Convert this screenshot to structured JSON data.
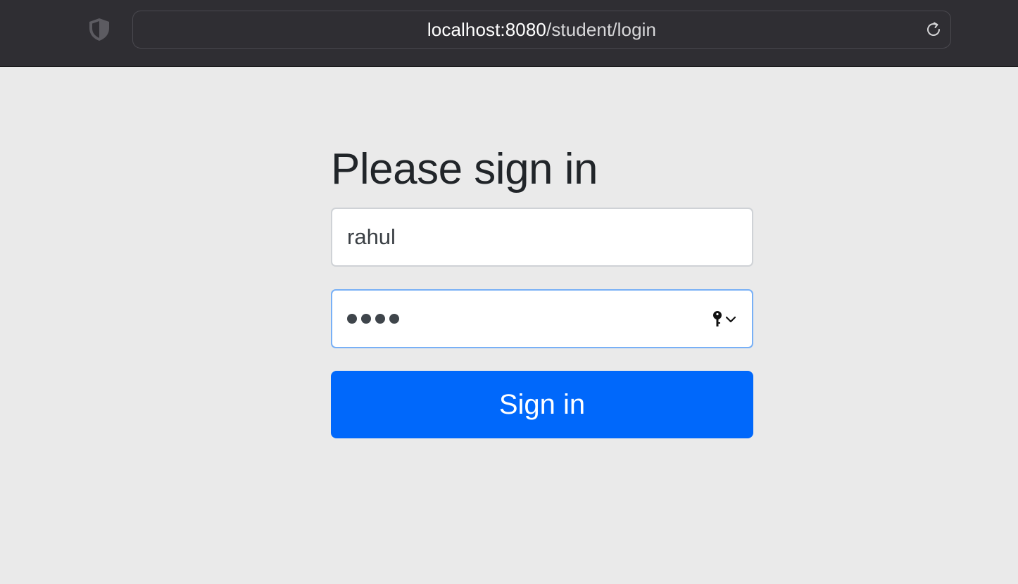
{
  "browser": {
    "url_host": "localhost:8080",
    "url_path": "/student/login",
    "icons": [
      "shield-icon",
      "reload-icon"
    ]
  },
  "form": {
    "heading": "Please sign in",
    "username_value": "rahul",
    "password_masked_length": 4,
    "password_icons": [
      "key-icon",
      "chevron-down-icon"
    ],
    "submit_label": "Sign in"
  },
  "colors": {
    "toolbar_bg": "#2f2e33",
    "page_bg": "#eaeaea",
    "button_bg": "#0068fb",
    "focus_border": "#78b0f6"
  }
}
